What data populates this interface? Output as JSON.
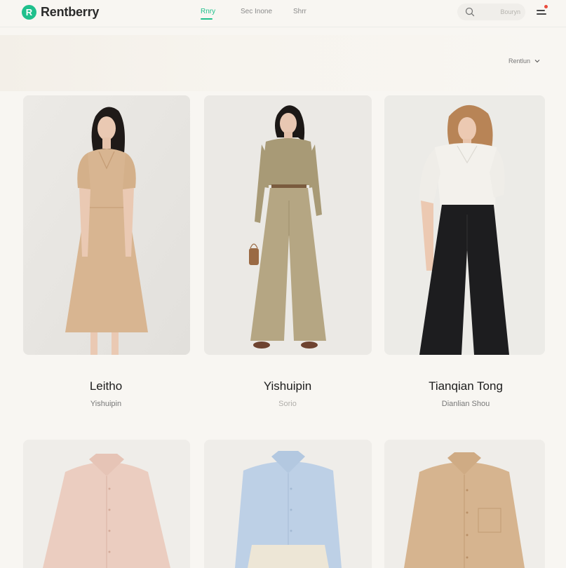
{
  "app": {
    "brand_initial": "R",
    "brand_name": "Rentberry"
  },
  "nav": {
    "items": [
      {
        "label": "Rnry",
        "active": true
      },
      {
        "label": "Sec Inone",
        "active": false
      },
      {
        "label": "Shrr",
        "active": false
      }
    ]
  },
  "search": {
    "placeholder": "Bouryn"
  },
  "sort": {
    "label": "Rentlun"
  },
  "products": [
    {
      "title": "Leitho",
      "subtitle": "Yishuipin"
    },
    {
      "title": "Yishuipin",
      "subtitle": "Sorio"
    },
    {
      "title": "Tianqian Tong",
      "subtitle": "Dianlian Shou"
    },
    {
      "title": "",
      "subtitle": ""
    },
    {
      "title": "",
      "subtitle": ""
    },
    {
      "title": "",
      "subtitle": ""
    }
  ],
  "colors": {
    "accent": "#1fc08c",
    "background": "#f8f6f2",
    "notification": "#e94b3c"
  },
  "icons": {
    "search": "search-icon",
    "menu": "menu-icon",
    "sort": "chevron-down-icon"
  }
}
